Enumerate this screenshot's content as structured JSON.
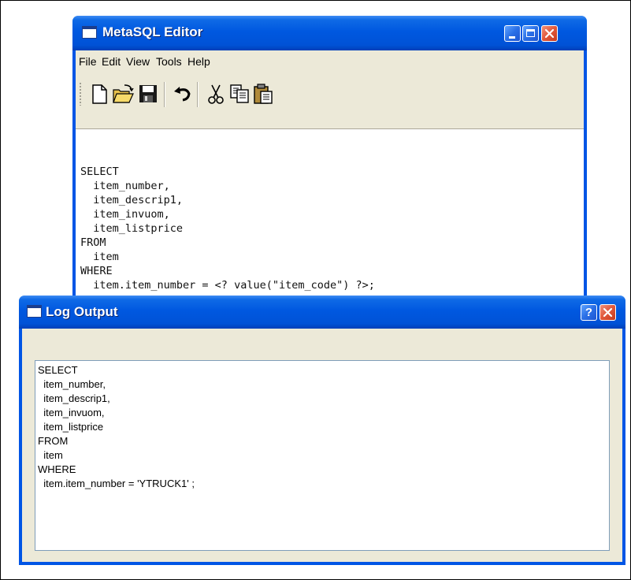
{
  "editor": {
    "title": "MetaSQL Editor",
    "menu": [
      "File",
      "Edit",
      "View",
      "Tools",
      "Help"
    ],
    "toolbar": {
      "new": "new-document-icon",
      "open": "open-folder-icon",
      "save": "save-disk-icon",
      "undo": "undo-icon",
      "cut": "cut-scissors-icon",
      "copy": "copy-icon",
      "paste": "paste-icon"
    },
    "code": "SELECT\n  item_number,\n  item_descrip1,\n  item_invuom,\n  item_listprice\nFROM\n  item\nWHERE\n  item.item_number = <? value(\"item_code\") ?>;"
  },
  "log": {
    "title": "Log Output",
    "text": "SELECT\n  item_number,\n  item_descrip1,\n  item_invuom,\n  item_listprice\nFROM\n  item\nWHERE\n  item.item_number = 'YTRUCK1' ;"
  },
  "colors": {
    "title_bar": "#0058e0",
    "window_face": "#ece9d8",
    "close_button": "#e0573a"
  }
}
